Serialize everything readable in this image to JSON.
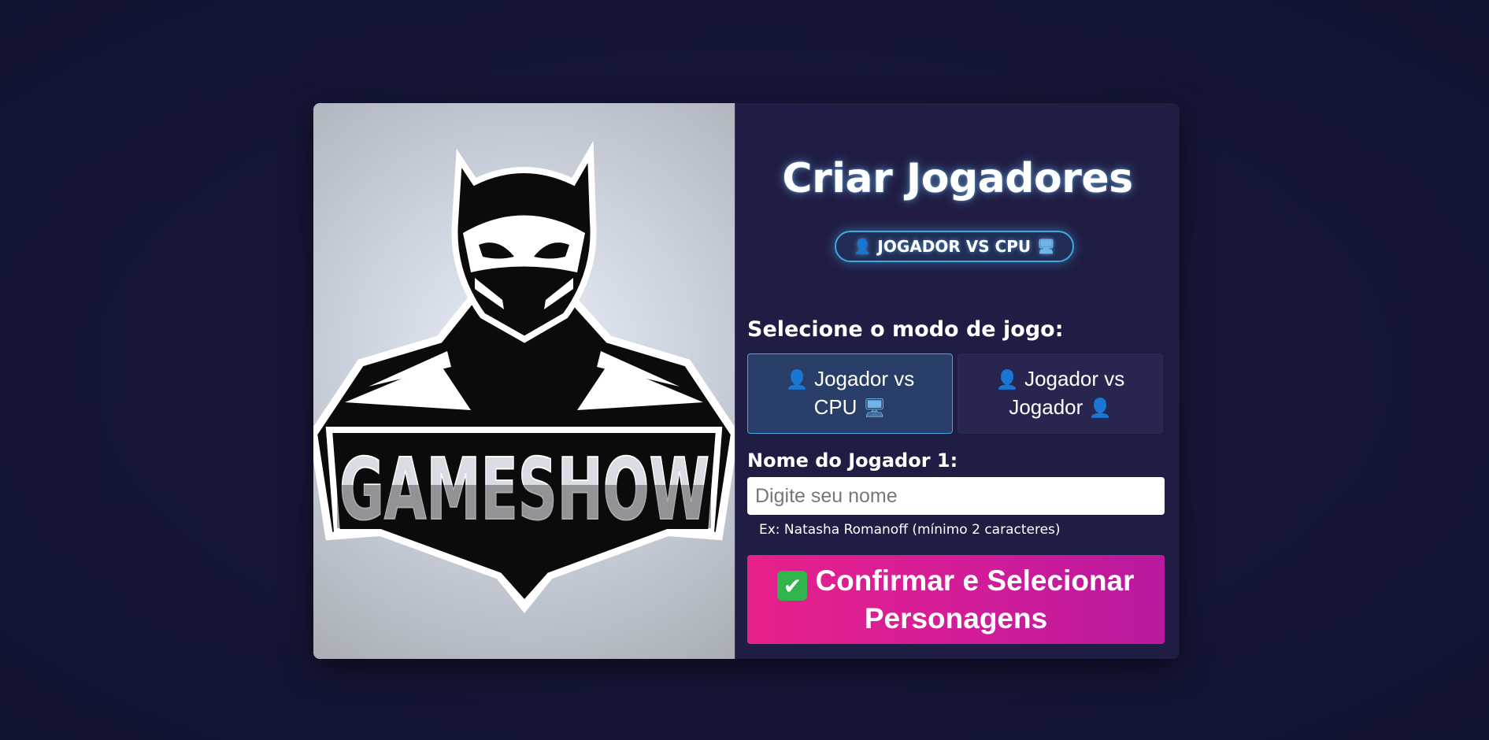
{
  "logo": {
    "text": "GAMESHOW"
  },
  "header": {
    "title": "Criar Jogadores",
    "mode_badge": "JOGADOR VS CPU",
    "mode_badge_icon_left": "user-icon",
    "mode_badge_icon_right": "computer-icon"
  },
  "mode_select": {
    "label": "Selecione o modo de jogo:",
    "options": [
      {
        "line1": "Jogador vs",
        "line2": "CPU",
        "icon_left": "user-icon",
        "icon_right": "computer-icon",
        "selected": true
      },
      {
        "line1": "Jogador vs",
        "line2": "Jogador",
        "icon_left": "user-icon",
        "icon_right": "user-icon",
        "selected": false
      }
    ]
  },
  "player_form": {
    "label": "Nome do Jogador 1:",
    "value": "",
    "placeholder": "Digite seu nome",
    "hint": "Ex: Natasha Romanoff (mínimo 2 caracteres)"
  },
  "confirm": {
    "line1": "Confirmar e Selecionar",
    "line2": "Personagens",
    "icon": "check-mark-icon"
  },
  "colors": {
    "accent_blue": "#3ea8e0",
    "accent_pink": "#e8208a",
    "accent_purple": "#b8199e",
    "background": "#16163a",
    "panel": "#201d44"
  }
}
